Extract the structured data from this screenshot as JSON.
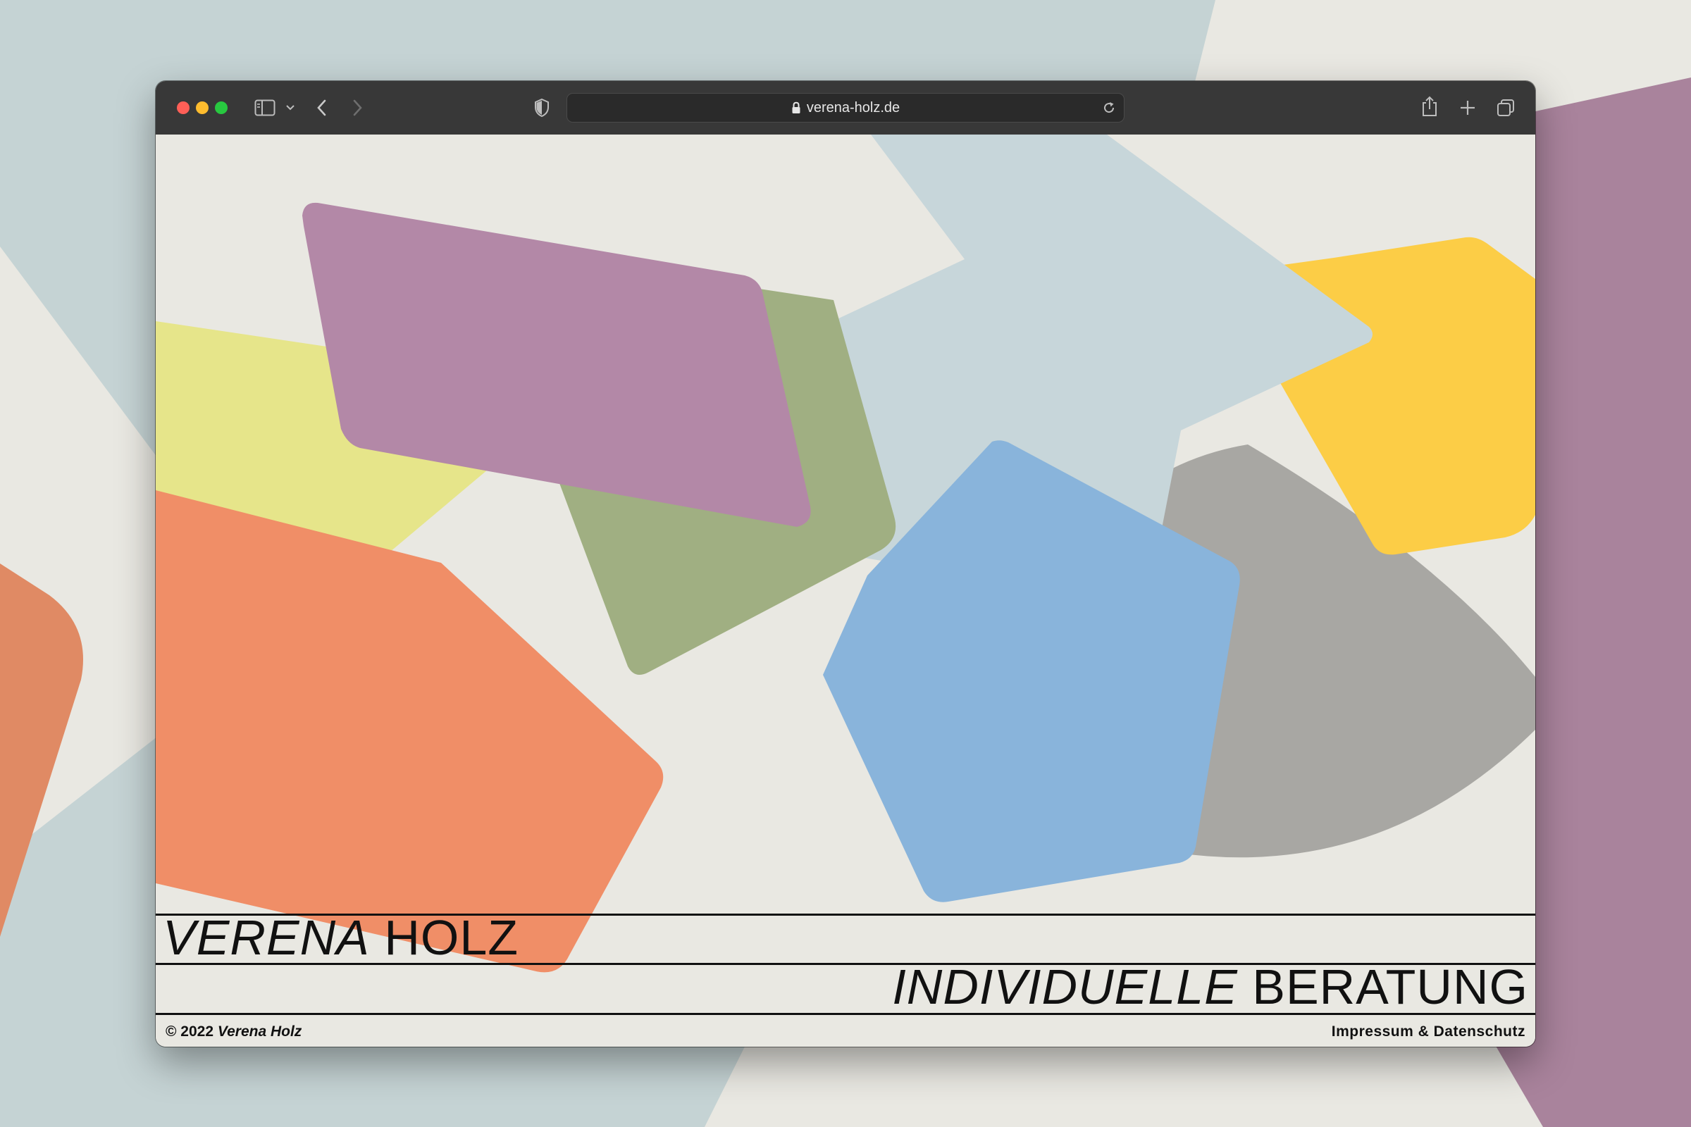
{
  "browser": {
    "url": "verena-holz.de",
    "traffic_lights": {
      "close": "#ff5f57",
      "minimize": "#febc2e",
      "zoom": "#28c840"
    },
    "icons": [
      "sidebar-icon",
      "chevron-down-icon",
      "back-icon",
      "forward-icon",
      "shield-icon",
      "lock-icon",
      "reload-icon",
      "share-icon",
      "new-tab-icon",
      "tab-overview-icon"
    ]
  },
  "site": {
    "name_first": "VERENA",
    "name_last": "HOLZ",
    "tagline_italic": "INDIVIDUELLE",
    "tagline_regular": "BERATUNG",
    "footer": {
      "copyright_prefix": "© 2022",
      "copyright_name": "Verena Holz",
      "legal_link": "Impressum & Datenschutz"
    }
  },
  "colors": {
    "page_bg": "#e9e8e2",
    "mauve": "#b388a7",
    "sage": "#a0af82",
    "coral": "#f08e67",
    "lime": "#e6e58a",
    "pale_blue": "#c7d6da",
    "sky_blue": "#89b4db",
    "yellow": "#fccd46",
    "grey": "#a8a7a3",
    "text": "#111111"
  }
}
